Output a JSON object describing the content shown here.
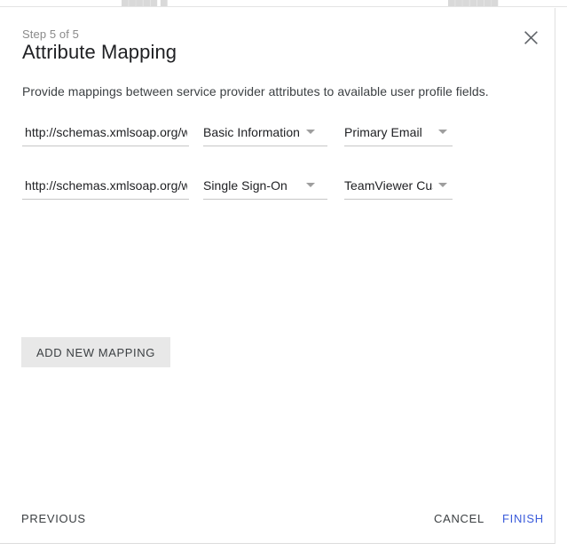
{
  "background_page": {
    "ghost_left": "█████ █",
    "ghost_right": "███████"
  },
  "dialog": {
    "step_label": "Step 5 of 5",
    "title": "Attribute Mapping",
    "description": "Provide mappings between service provider attributes to available user profile fields.",
    "close_icon": "close-icon",
    "mappings": [
      {
        "attribute_uri": "http://schemas.xmlsoap.org/w",
        "category": "Basic Information",
        "field": "Primary Email"
      },
      {
        "attribute_uri": "http://schemas.xmlsoap.org/w",
        "category": "Single Sign-On",
        "field": "TeamViewer Cus..."
      }
    ],
    "add_mapping_label": "ADD NEW MAPPING",
    "footer": {
      "previous_label": "PREVIOUS",
      "cancel_label": "CANCEL",
      "finish_label": "FINISH",
      "finish_color": "#3b5cdb"
    }
  }
}
